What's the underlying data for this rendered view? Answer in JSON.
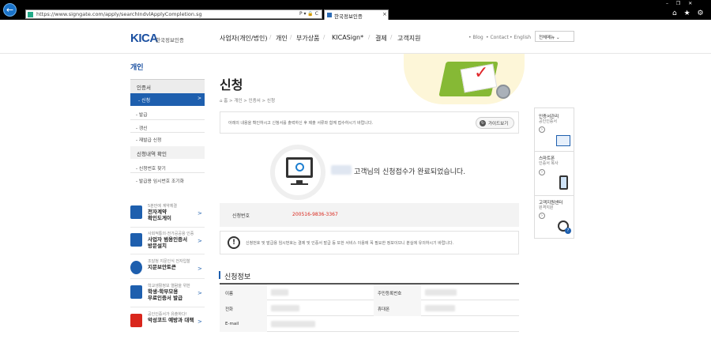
{
  "browser": {
    "url": "https://www.signgate.com/apply/searchIndvlApplyCompletion.sg",
    "tab_title": "한국정보인증",
    "tab_close": "×",
    "back": "←",
    "addr_tools": "P ▾ 🔒 C",
    "window_controls": "– ❐ ✕",
    "nav_icons": "⌂ ★ ⚙"
  },
  "header": {
    "logo_mark": "KICA",
    "logo_text": "한국정보인증",
    "gnb": [
      "사업자(개인/법인)",
      "개인",
      "부가상품",
      "KICASign*",
      "결제",
      "고객지원"
    ],
    "gnb_sep": "/",
    "util": [
      "• Blog",
      "• Contact",
      "• English"
    ],
    "all_menu": "전체메뉴 ⌄"
  },
  "sidebar": {
    "title": "개인",
    "section1": "인증서",
    "active_item": "- 신청",
    "active_arrow": ">",
    "sub_items": [
      "- 발급",
      "- 갱신",
      "- 재발급 신청"
    ],
    "section2": "신청내역 확인",
    "sub_items2": [
      "- 신청번호 찾기",
      "- 발급용 임시번호 조기화"
    ],
    "promos": [
      {
        "small": "5분만에 계약체결",
        "large": "전자계약\n확인도게이",
        "arrow": ">"
      },
      {
        "small": "사회적통의·전가공공용 인증",
        "large": "사업자 범용인증서\n방문설치",
        "arrow": ">"
      },
      {
        "small": "조달청 지문인식 전자입찰",
        "large": "지문보안토큰",
        "arrow": ">"
      },
      {
        "small": "학교생활정보 열람을 위한",
        "large": "학생·학부모용\n무료인증서 발급",
        "arrow": ">"
      },
      {
        "small": "공인인증서가 유출하다!",
        "large": "악성코드 예방과 대책",
        "arrow": ">"
      }
    ]
  },
  "main": {
    "title": "신청",
    "breadcrumb": "⌂ 홈 > 개인 > 인증서 > 신청",
    "notice": "아래의 내용을 확인하시고 신청서를 출력하신 후 제출 서류와 함께 접수하시기 바랍니다.",
    "guide_button": "가이드보기",
    "guide_icon": "↻",
    "done_message": "고객님의 신청접수가 완료되었습니다.",
    "app_no_label": "신청번호",
    "app_no_value": "200516-9836-3367",
    "warning_icon": "!",
    "warning": "신청번호 및 발급용 임시번호는 결제 및 인증서 발급 등 또한 서비스 이용에 꼭 필요한 정보이므니 분실에 유의하시기 바랍니다.",
    "section_title": "신청정보",
    "table": {
      "row1": {
        "label_left": "이름",
        "label_right": "주민등록번호"
      },
      "row2": {
        "label_left": "전화",
        "label_right": "휴대폰"
      },
      "row3": {
        "label_left": "E-mail"
      }
    }
  },
  "quick_menu": [
    {
      "title": "인증서관리",
      "sub": "공인인증서"
    },
    {
      "title": "스마트폰",
      "sub": "인증서 복사"
    },
    {
      "title": "고객지원센터",
      "sub": "원격지원"
    }
  ],
  "quick_go": "›",
  "quick_badge": "?"
}
